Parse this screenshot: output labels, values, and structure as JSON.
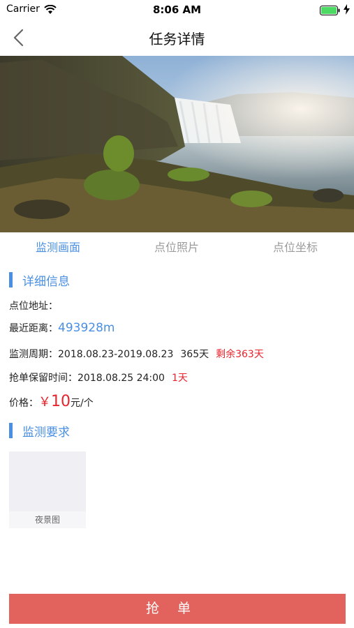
{
  "status_bar": {
    "carrier": "Carrier",
    "time": "8:06 AM"
  },
  "nav": {
    "title": "任务详情",
    "back_icon": "chevron-left-icon"
  },
  "hero": {
    "alt": "waterfall landscape photo"
  },
  "tabs": [
    {
      "label": "监测画面",
      "active": true
    },
    {
      "label": "点位照片",
      "active": false
    },
    {
      "label": "点位坐标",
      "active": false
    }
  ],
  "details": {
    "section_title": "详细信息",
    "address_label": "点位地址：",
    "distance_label": "最近距离：",
    "distance_value": "493928m",
    "period_label": "监测周期：",
    "period_range": "2018.08.23-2019.08.23",
    "period_days": "365天",
    "period_remaining": "剩余363天",
    "hold_label": "抢单保留时间：",
    "hold_time": "2018.08.25 24:00",
    "hold_days": "1天",
    "price_label": "价格：",
    "price_symbol": "￥",
    "price_value": "10",
    "price_unit": "元/个"
  },
  "requirements": {
    "section_title": "监测要求",
    "items": [
      {
        "caption": "夜景图"
      }
    ]
  },
  "action": {
    "label": "抢单"
  },
  "colors": {
    "accent": "#4a8fe2",
    "danger": "#e8232c",
    "button": "#e2635e"
  }
}
